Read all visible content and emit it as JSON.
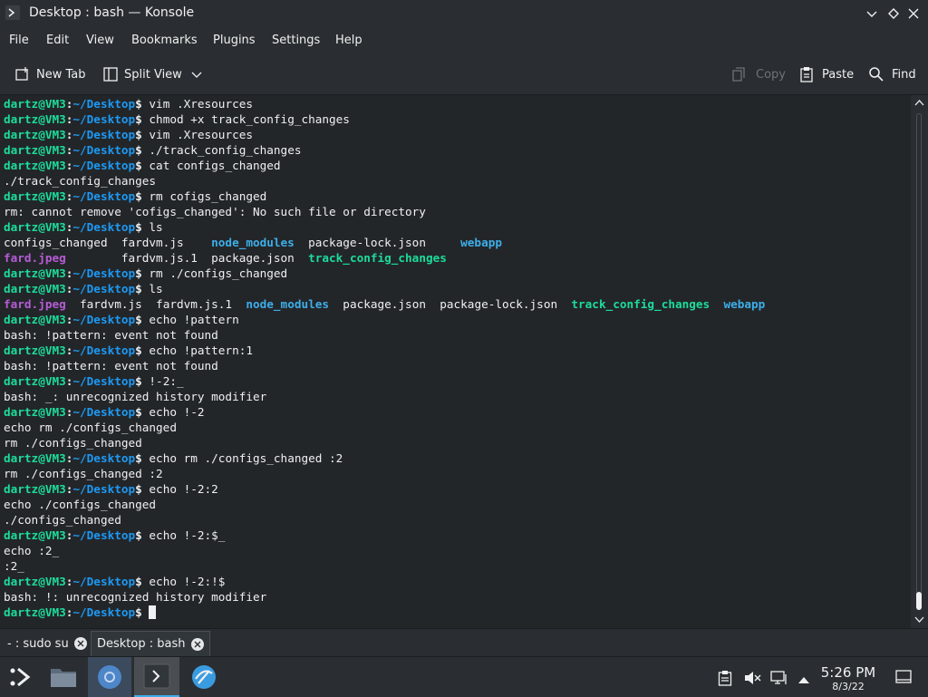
{
  "window": {
    "title": "Desktop : bash — Konsole"
  },
  "menu": [
    "File",
    "Edit",
    "View",
    "Bookmarks",
    "Plugins",
    "Settings",
    "Help"
  ],
  "toolbar": {
    "new_tab": "New Tab",
    "split_view": "Split View",
    "copy": "Copy",
    "paste": "Paste",
    "find": "Find"
  },
  "colors": {
    "prompt_user": "#1cdc9a",
    "prompt_path": "#1d99f3",
    "dir": "#3daee9",
    "exec": "#1cdc9a",
    "image": "#b65cd6",
    "text": "#eff0f1"
  },
  "terminal": {
    "prompt": {
      "user": "dartz@VM3",
      "sep": ":",
      "path": "~/Desktop",
      "dollar": "$ "
    },
    "lines": [
      {
        "cmd": "vim .Xresources"
      },
      {
        "cmd": "chmod +x track_config_changes"
      },
      {
        "cmd": "vim .Xresources"
      },
      {
        "cmd": "./track_config_changes"
      },
      {
        "cmd": "cat configs_changed"
      },
      {
        "out": [
          {
            "t": "./track_config_changes",
            "c": "text"
          }
        ]
      },
      {
        "cmd": "rm cofigs_changed"
      },
      {
        "out": [
          {
            "t": "rm: cannot remove 'cofigs_changed': No such file or directory",
            "c": "text"
          }
        ]
      },
      {
        "cmd": "ls"
      },
      {
        "out": [
          {
            "t": "configs_changed  fardvm.js    ",
            "c": "text"
          },
          {
            "t": "node_modules",
            "c": "dir"
          },
          {
            "t": "  package-lock.json     ",
            "c": "text"
          },
          {
            "t": "webapp",
            "c": "dir"
          }
        ]
      },
      {
        "out": [
          {
            "t": "fard.jpeg",
            "c": "image"
          },
          {
            "t": "        fardvm.js.1  package.json  ",
            "c": "text"
          },
          {
            "t": "track_config_changes",
            "c": "exec"
          }
        ]
      },
      {
        "cmd": "rm ./configs_changed"
      },
      {
        "cmd": "ls"
      },
      {
        "out": [
          {
            "t": "fard.jpeg",
            "c": "image"
          },
          {
            "t": "  fardvm.js  fardvm.js.1  ",
            "c": "text"
          },
          {
            "t": "node_modules",
            "c": "dir"
          },
          {
            "t": "  package.json  package-lock.json  ",
            "c": "text"
          },
          {
            "t": "track_config_changes",
            "c": "exec"
          },
          {
            "t": "  ",
            "c": "text"
          },
          {
            "t": "webapp",
            "c": "dir"
          }
        ]
      },
      {
        "cmd": "echo !pattern"
      },
      {
        "out": [
          {
            "t": "bash: !pattern: event not found",
            "c": "text"
          }
        ]
      },
      {
        "cmd": "echo !pattern:1"
      },
      {
        "out": [
          {
            "t": "bash: !pattern: event not found",
            "c": "text"
          }
        ]
      },
      {
        "cmd": "!-2:_"
      },
      {
        "out": [
          {
            "t": "bash: _: unrecognized history modifier",
            "c": "text"
          }
        ]
      },
      {
        "cmd": "echo !-2"
      },
      {
        "out": [
          {
            "t": "echo rm ./configs_changed",
            "c": "text"
          }
        ]
      },
      {
        "out": [
          {
            "t": "rm ./configs_changed",
            "c": "text"
          }
        ]
      },
      {
        "cmd": "echo rm ./configs_changed :2"
      },
      {
        "out": [
          {
            "t": "rm ./configs_changed :2",
            "c": "text"
          }
        ]
      },
      {
        "cmd": "echo !-2:2"
      },
      {
        "out": [
          {
            "t": "echo ./configs_changed",
            "c": "text"
          }
        ]
      },
      {
        "out": [
          {
            "t": "./configs_changed",
            "c": "text"
          }
        ]
      },
      {
        "cmd": "echo !-2:$_"
      },
      {
        "out": [
          {
            "t": "echo :2_",
            "c": "text"
          }
        ]
      },
      {
        "out": [
          {
            "t": ":2_",
            "c": "text"
          }
        ]
      },
      {
        "cmd": "echo !-2:!$"
      },
      {
        "out": [
          {
            "t": "bash: !: unrecognized history modifier",
            "c": "text"
          }
        ]
      },
      {
        "cmd": "",
        "cursor": true
      }
    ]
  },
  "tabs": [
    {
      "label": "- : sudo su",
      "active": false
    },
    {
      "label": "Desktop : bash",
      "active": true
    }
  ],
  "taskbar": {
    "items": [
      "application-launcher-icon",
      "file-manager-icon",
      "chromium-icon",
      "konsole-icon",
      "browser-icon"
    ],
    "tray": [
      "clipboard-icon",
      "volume-muted-icon",
      "network-icon",
      "expand-tray-icon"
    ],
    "clock_time": "5:26 PM",
    "clock_date": "8/3/22"
  }
}
